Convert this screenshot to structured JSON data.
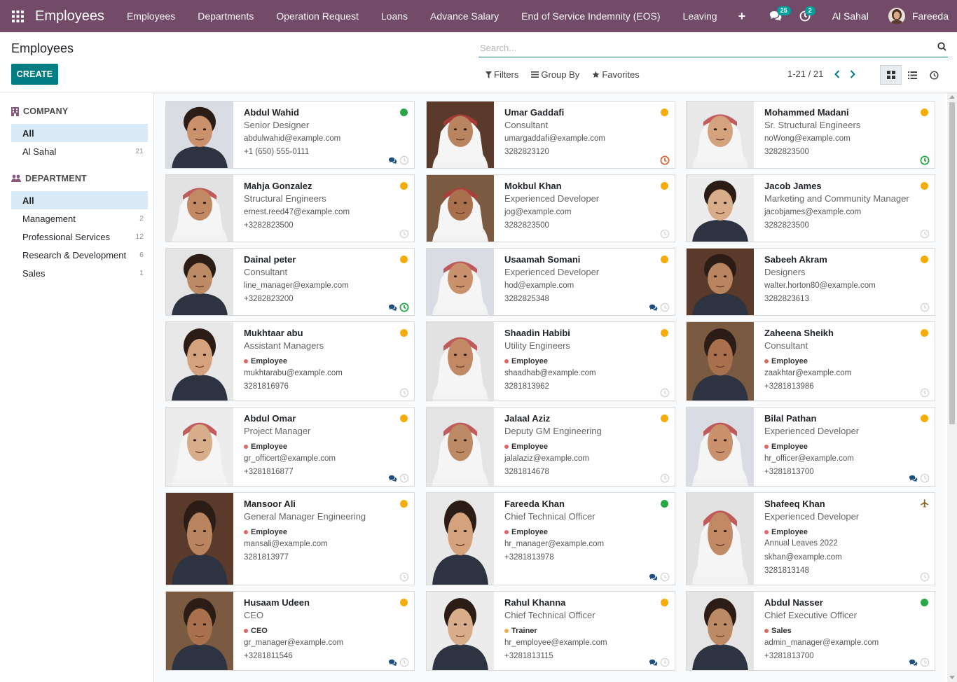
{
  "navbar": {
    "app_title": "Employees",
    "menu": [
      "Employees",
      "Departments",
      "Operation Request",
      "Loans",
      "Advance Salary",
      "End of Service Indemnity (EOS)",
      "Leaving"
    ],
    "plus": "+",
    "messages_count": "25",
    "activities_count": "2",
    "company": "Al Sahal",
    "user": "Fareeda",
    "accent_color": "#714b67"
  },
  "control_panel": {
    "title": "Employees",
    "create_label": "CREATE",
    "search_placeholder": "Search...",
    "filters_label": "Filters",
    "groupby_label": "Group By",
    "favorites_label": "Favorites",
    "pager": "1-21 / 21"
  },
  "sidebar": {
    "company_header": "COMPANY",
    "company_items": [
      {
        "label": "All",
        "count": ""
      },
      {
        "label": "Al Sahal",
        "count": "21"
      }
    ],
    "department_header": "DEPARTMENT",
    "department_items": [
      {
        "label": "All",
        "count": ""
      },
      {
        "label": "Management",
        "count": "2"
      },
      {
        "label": "Professional Services",
        "count": "12"
      },
      {
        "label": "Research & Development",
        "count": "6"
      },
      {
        "label": "Sales",
        "count": "1"
      }
    ]
  },
  "employees": [
    {
      "name": "Abdul Wahid",
      "job": "Senior Designer",
      "tag": "",
      "extra": "",
      "email": "abdulwahid@example.com",
      "phone": "+1 (650) 555-0111",
      "status": "green",
      "chat": true,
      "clock": "grey"
    },
    {
      "name": "Umar Gaddafi",
      "job": "Consultant",
      "tag": "",
      "extra": "",
      "email": "umargaddafi@example.com",
      "phone": "3282823120",
      "status": "yellow",
      "chat": false,
      "clock": "orange"
    },
    {
      "name": "Mohammed Madani",
      "job": "Sr. Structural Engineers",
      "tag": "",
      "extra": "",
      "email": "noWong@example.com",
      "phone": "3282823500",
      "status": "yellow",
      "chat": false,
      "clock": "green"
    },
    {
      "name": "Mahja Gonzalez",
      "job": "Structural Engineers",
      "tag": "",
      "extra": "",
      "email": "ernest.reed47@example.com",
      "phone": "+3282823500",
      "status": "yellow",
      "chat": false,
      "clock": "grey"
    },
    {
      "name": "Mokbul Khan",
      "job": "Experienced Developer",
      "tag": "",
      "extra": "",
      "email": "jog@example.com",
      "phone": "3282823500",
      "status": "yellow",
      "chat": false,
      "clock": "grey"
    },
    {
      "name": "Jacob James",
      "job": "Marketing and Community Manager",
      "tag": "",
      "extra": "",
      "email": "jacobjames@example.com",
      "phone": "3282823500",
      "status": "yellow",
      "chat": false,
      "clock": "grey"
    },
    {
      "name": "Dainal peter",
      "job": "Consultant",
      "tag": "",
      "extra": "",
      "email": "line_manager@example.com",
      "phone": "+3282823200",
      "status": "yellow",
      "chat": true,
      "clock": "green"
    },
    {
      "name": "Usaamah Somani",
      "job": "Experienced Developer",
      "tag": "",
      "extra": "",
      "email": "hod@example.com",
      "phone": "3282825348",
      "status": "yellow",
      "chat": true,
      "clock": "grey"
    },
    {
      "name": "Sabeeh Akram",
      "job": "Designers",
      "tag": "",
      "extra": "",
      "email": "walter.horton80@example.com",
      "phone": "3282823613",
      "status": "yellow",
      "chat": false,
      "clock": "grey"
    },
    {
      "name": "Mukhtaar abu",
      "job": "Assistant Managers",
      "tag": "Employee",
      "extra": "",
      "email": "mukhtarabu@example.com",
      "phone": "3281816976",
      "status": "yellow",
      "chat": false,
      "clock": "grey"
    },
    {
      "name": "Shaadin Habibi",
      "job": "Utility Engineers",
      "tag": "Employee",
      "extra": "",
      "email": "shaadhab@example.com",
      "phone": "3281813962",
      "status": "yellow",
      "chat": false,
      "clock": "grey"
    },
    {
      "name": "Zaheena Sheikh",
      "job": "Consultant",
      "tag": "Employee",
      "extra": "",
      "email": "zaakhtar@example.com",
      "phone": "+3281813986",
      "status": "yellow",
      "chat": false,
      "clock": "grey"
    },
    {
      "name": "Abdul Omar",
      "job": "Project Manager",
      "tag": "Employee",
      "extra": "",
      "email": "gr_officert@example.com",
      "phone": "+3281816877",
      "status": "yellow",
      "chat": true,
      "clock": "grey"
    },
    {
      "name": "Jalaal Aziz",
      "job": "Deputy GM Engineering",
      "tag": "Employee",
      "extra": "",
      "email": "jalalaziz@example.com",
      "phone": "3281814678",
      "status": "yellow",
      "chat": false,
      "clock": "grey"
    },
    {
      "name": "Bilal Pathan",
      "job": "Experienced Developer",
      "tag": "Employee",
      "extra": "",
      "email": "hr_officer@example.com",
      "phone": "+3281813700",
      "status": "yellow",
      "chat": true,
      "clock": "grey"
    },
    {
      "name": "Mansoor Ali",
      "job": "General Manager Engineering",
      "tag": "Employee",
      "extra": "",
      "email": "mansali@example.com",
      "phone": "3281813977",
      "status": "yellow",
      "chat": false,
      "clock": "grey"
    },
    {
      "name": "Fareeda Khan",
      "job": "Chief Technical Officer",
      "tag": "Employee",
      "extra": "",
      "email": "hr_manager@example.com",
      "phone": "+3281813978",
      "status": "green",
      "chat": true,
      "clock": "grey"
    },
    {
      "name": "Shafeeq Khan",
      "job": "Experienced Developer",
      "tag": "Employee",
      "extra": "Annual Leaves 2022",
      "email": "skhan@example.com",
      "phone": "3281813148",
      "status": "plane",
      "chat": false,
      "clock": "grey"
    },
    {
      "name": "Husaam Udeen",
      "job": "CEO",
      "tag": "CEO",
      "extra": "",
      "email": "gr_manager@example.com",
      "phone": "+3281811546",
      "status": "yellow",
      "chat": true,
      "clock": "grey"
    },
    {
      "name": "Rahul Khanna",
      "job": "Chief Technical Officer",
      "tag": "Trainer",
      "extra": "",
      "email": "hr_employee@example.com",
      "phone": "+3281813115",
      "status": "yellow",
      "chat": true,
      "clock": "grey"
    },
    {
      "name": "Abdul Nasser",
      "job": "Chief Executive Officer",
      "tag": "Sales",
      "extra": "",
      "email": "admin_manager@example.com",
      "phone": "+3281813700",
      "status": "green",
      "chat": true,
      "clock": "grey"
    }
  ]
}
